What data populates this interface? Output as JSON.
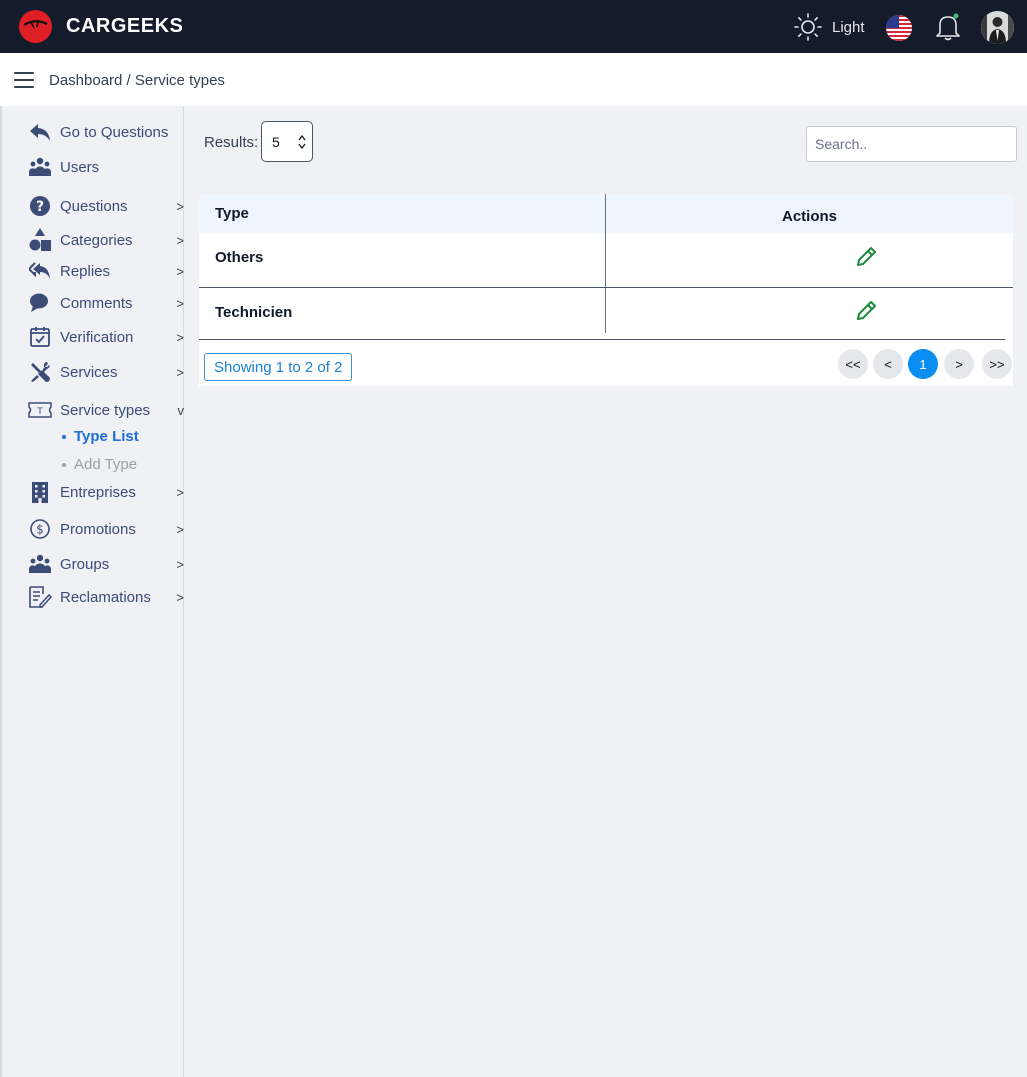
{
  "header": {
    "brand": "CARGEEKS",
    "theme_label": "Light",
    "icons": [
      "logo",
      "sun-icon",
      "us-flag-icon",
      "bell-icon",
      "user-avatar"
    ]
  },
  "breadcrumb": {
    "text": "Dashboard / Service types"
  },
  "sidebar": {
    "items": [
      {
        "label": "Go to Questions",
        "icon": "reply-arrow-icon",
        "arrow": ""
      },
      {
        "label": "Users",
        "icon": "users-icon",
        "arrow": ""
      },
      {
        "label": "Questions",
        "icon": "question-circle-icon",
        "arrow": ">"
      },
      {
        "label": "Categories",
        "icon": "shapes-icon",
        "arrow": ">"
      },
      {
        "label": "Replies",
        "icon": "reply-all-icon",
        "arrow": ">"
      },
      {
        "label": "Comments",
        "icon": "comments-icon",
        "arrow": ">"
      },
      {
        "label": "Verification",
        "icon": "calendar-check-icon",
        "arrow": ">"
      },
      {
        "label": "Services",
        "icon": "tools-icon",
        "arrow": ">"
      },
      {
        "label": "Service types",
        "icon": "ticket-icon",
        "arrow": "v"
      },
      {
        "label": "Entreprises",
        "icon": "building-icon",
        "arrow": ">"
      },
      {
        "label": "Promotions",
        "icon": "dollar-circle-icon",
        "arrow": ">"
      },
      {
        "label": "Groups",
        "icon": "users-icon",
        "arrow": ">"
      },
      {
        "label": "Reclamations",
        "icon": "document-edit-icon",
        "arrow": ">"
      }
    ],
    "subitems": [
      {
        "label": "Type List",
        "active": true
      },
      {
        "label": "Add Type",
        "active": false
      }
    ]
  },
  "controls": {
    "results_label": "Results:",
    "results_value": "5",
    "search_placeholder": "Search.."
  },
  "table": {
    "headers": [
      "Type",
      "Actions"
    ],
    "rows": [
      {
        "type": "Others",
        "action_icon": "pencil-icon"
      },
      {
        "type": "Technicien",
        "action_icon": "pencil-icon"
      }
    ],
    "showing": "Showing 1 to 2 of 2"
  },
  "pagination": {
    "first": "<<",
    "prev": "<",
    "current": "1",
    "next": ">",
    "last": ">>"
  },
  "colors": {
    "topbar": "#141c2b",
    "accent": "#0b8ef2",
    "nav_text": "#3b4c77",
    "edit_icon": "#1e8a3e"
  }
}
